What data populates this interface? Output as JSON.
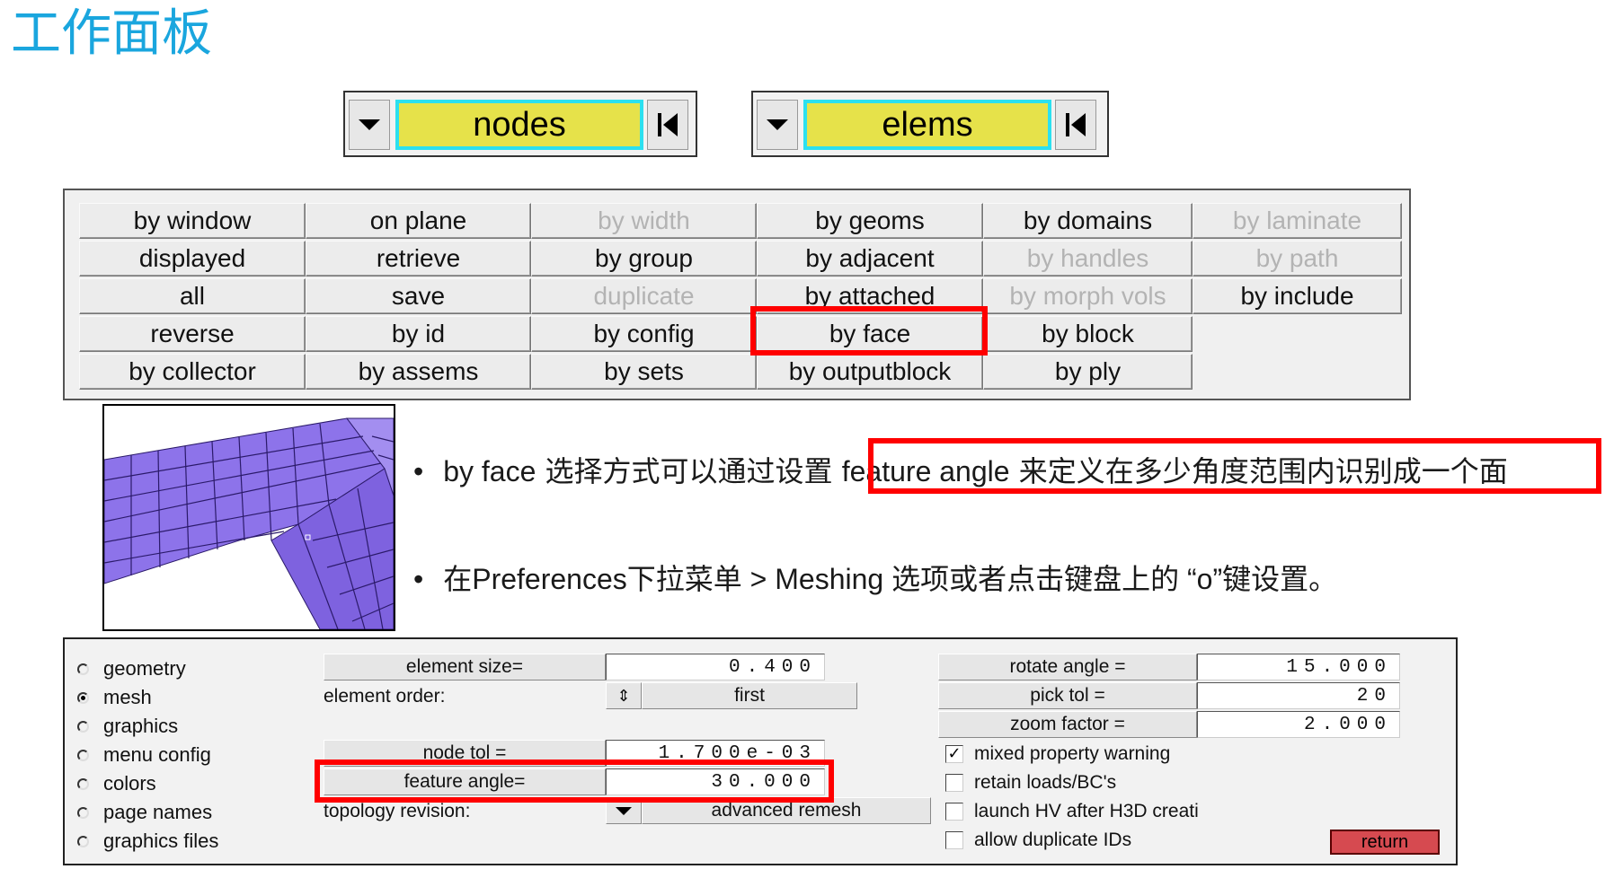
{
  "title": "工作面板",
  "selectors": [
    {
      "label": "nodes"
    },
    {
      "label": "elems"
    }
  ],
  "grid": {
    "buttons": [
      {
        "label": "by window",
        "disabled": false
      },
      {
        "label": "on plane",
        "disabled": false
      },
      {
        "label": "by width",
        "disabled": true
      },
      {
        "label": "by geoms",
        "disabled": false
      },
      {
        "label": "by domains",
        "disabled": false
      },
      {
        "label": "by laminate",
        "disabled": true
      },
      {
        "label": "displayed",
        "disabled": false
      },
      {
        "label": "retrieve",
        "disabled": false
      },
      {
        "label": "by group",
        "disabled": false
      },
      {
        "label": "by adjacent",
        "disabled": false
      },
      {
        "label": "by handles",
        "disabled": true
      },
      {
        "label": "by path",
        "disabled": true
      },
      {
        "label": "all",
        "disabled": false
      },
      {
        "label": "save",
        "disabled": false
      },
      {
        "label": "duplicate",
        "disabled": true
      },
      {
        "label": "by attached",
        "disabled": false
      },
      {
        "label": "by morph vols",
        "disabled": true
      },
      {
        "label": "by include",
        "disabled": false
      },
      {
        "label": "reverse",
        "disabled": false
      },
      {
        "label": "by id",
        "disabled": false
      },
      {
        "label": "by config",
        "disabled": false
      },
      {
        "label": "by face",
        "disabled": false
      },
      {
        "label": "by block",
        "disabled": false
      },
      {
        "label": "by collector",
        "disabled": false
      },
      {
        "label": "by assems",
        "disabled": false
      },
      {
        "label": "by sets",
        "disabled": false
      },
      {
        "label": "by outputblock",
        "disabled": false
      },
      {
        "label": "by ply",
        "disabled": false
      }
    ]
  },
  "bullets": [
    {
      "marker": "•",
      "prefix": "by face",
      "zh1": " 选择方式可以通过设置 ",
      "highlight_en": "feature angle",
      "highlight_zh": " 来定义在多少角度范围内识别成一个面"
    },
    {
      "marker": "•",
      "p1": "在",
      "p2": "Preferences",
      "p3": "下拉菜单",
      "p4": " > Meshing ",
      "p5": "选项或者点击键盘上的",
      "p6": " “o”",
      "p7": "键设置。"
    }
  ],
  "panel": {
    "radios": [
      {
        "label": "geometry",
        "selected": false
      },
      {
        "label": "mesh",
        "selected": true
      },
      {
        "label": "graphics",
        "selected": false
      },
      {
        "label": "menu config",
        "selected": false
      },
      {
        "label": "colors",
        "selected": false
      },
      {
        "label": "page names",
        "selected": false
      },
      {
        "label": "graphics files",
        "selected": false
      }
    ],
    "element_size_label": "element size=",
    "element_size_value": "0.400",
    "element_order_label": "element order:",
    "element_order_value": "first",
    "node_tol_label": "node tol =",
    "node_tol_value": "1.700e-03",
    "feature_angle_label": "feature angle=",
    "feature_angle_value": "30.000",
    "topology_revision_label": "topology revision:",
    "topology_revision_value": "advanced remesh",
    "rotate_angle_label": "rotate angle =",
    "rotate_angle_value": "15.000",
    "pick_tol_label": "pick tol =",
    "pick_tol_value": "20",
    "zoom_factor_label": "zoom factor =",
    "zoom_factor_value": "2.000",
    "checkboxes": [
      {
        "label": "mixed property warning",
        "checked": true
      },
      {
        "label": "retain loads/BC's",
        "checked": false
      },
      {
        "label": "launch HV after H3D creati",
        "checked": false
      },
      {
        "label": "allow duplicate IDs",
        "checked": false
      }
    ],
    "return_label": "return"
  },
  "colors": {
    "title": "#1aa6de",
    "highlight": "#ff0000",
    "selector_fill": "#e6e24a",
    "selector_border": "#2ce0ef",
    "mesh": "#8a6ee8",
    "return": "#d64a50"
  },
  "icons": {
    "dropdown": "triangle-down-icon",
    "first": "skip-to-first-icon",
    "spinner": "up-down-spinner-icon"
  }
}
